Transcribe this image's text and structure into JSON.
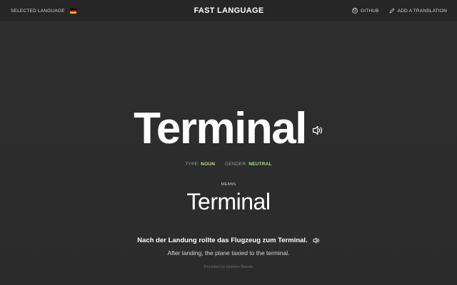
{
  "header": {
    "selected_language_label": "SELECTED LANGUAGE",
    "selected_language_flag": "german-flag",
    "title": "FAST LANGUAGE",
    "github_label": "GITHUB",
    "add_translation_label": "ADD A TRANSLATION"
  },
  "word": {
    "text": "Terminal",
    "audio_icon": "speaker-icon",
    "type_label": "TYPE:",
    "type_value": "NOUN",
    "gender_label": "GENDER:",
    "gender_value": "NEUTRAL"
  },
  "translation": {
    "means_label": "MEANS",
    "text": "Terminal"
  },
  "example": {
    "sentence": "Nach der Landung rollte das Flugzeug zum Terminal.",
    "audio_icon": "speaker-icon",
    "translation": "After landing, the plane taxied to the terminal."
  },
  "footer": {
    "credit": "Provided by Quinten Blands"
  },
  "colors": {
    "background": "#2d2d2d",
    "accent_green": "#b6e36b",
    "text": "#ffffff"
  }
}
